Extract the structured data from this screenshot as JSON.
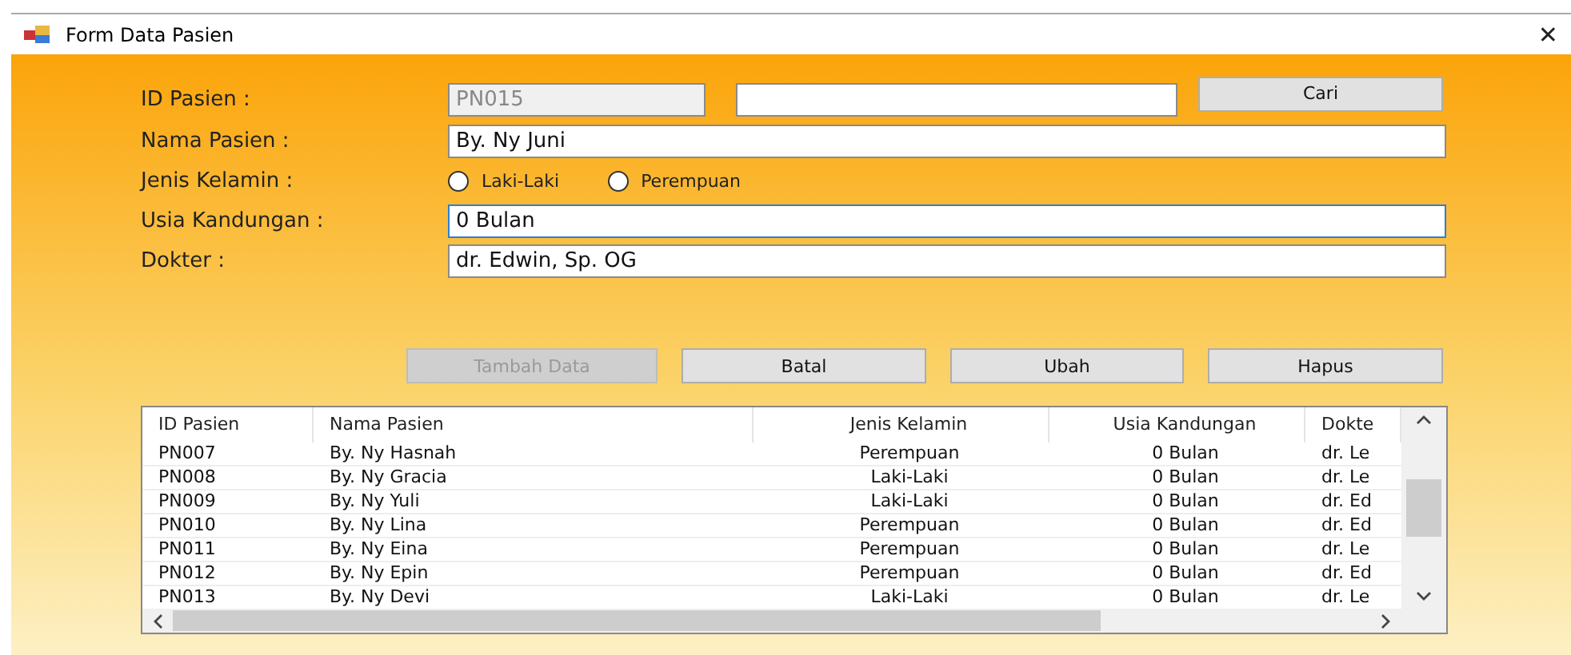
{
  "window": {
    "title": "Form Data Pasien",
    "close": "✕"
  },
  "form": {
    "id_label": "ID Pasien :",
    "id_value": "PN015",
    "id_disabled": true,
    "search_button": "Cari",
    "fields": [
      {
        "label": "Nama Pasien :",
        "kind": "text",
        "value": "By. Ny Juni",
        "focused": false
      },
      {
        "label": "Jenis Kelamin :",
        "kind": "radio",
        "options": [
          {
            "label": "Laki-Laki",
            "selected": false
          },
          {
            "label": "Perempuan",
            "selected": false
          }
        ]
      },
      {
        "label": "Usia Kandungan :",
        "kind": "text",
        "value": "0 Bulan",
        "focused": true
      },
      {
        "label": "Dokter :",
        "kind": "text",
        "value": "dr. Edwin, Sp. OG",
        "focused": false
      }
    ]
  },
  "buttons": [
    {
      "label": "Tambah Data",
      "disabled": true
    },
    {
      "label": "Batal",
      "disabled": false
    },
    {
      "label": "Ubah",
      "disabled": false
    },
    {
      "label": "Hapus",
      "disabled": false
    }
  ],
  "table": {
    "columns": [
      "ID Pasien",
      "Nama Pasien",
      "Jenis Kelamin",
      "Usia Kandungan",
      "Dokte"
    ],
    "rows": [
      [
        "PN007",
        "By. Ny Hasnah",
        "Perempuan",
        "0 Bulan",
        "dr. Le"
      ],
      [
        "PN008",
        "By. Ny Gracia",
        "Laki-Laki",
        "0 Bulan",
        "dr. Le"
      ],
      [
        "PN009",
        "By. Ny Yuli",
        "Laki-Laki",
        "0 Bulan",
        "dr. Ed"
      ],
      [
        "PN010",
        "By. Ny Lina",
        "Perempuan",
        "0 Bulan",
        "dr. Ed"
      ],
      [
        "PN011",
        "By. Ny Eina",
        "Perempuan",
        "0 Bulan",
        "dr. Le"
      ],
      [
        "PN012",
        "By. Ny Epin",
        "Perempuan",
        "0 Bulan",
        "dr. Ed"
      ],
      [
        "PN013",
        "By. Ny Devi",
        "Laki-Laki",
        "0 Bulan",
        "dr. Le"
      ]
    ]
  }
}
